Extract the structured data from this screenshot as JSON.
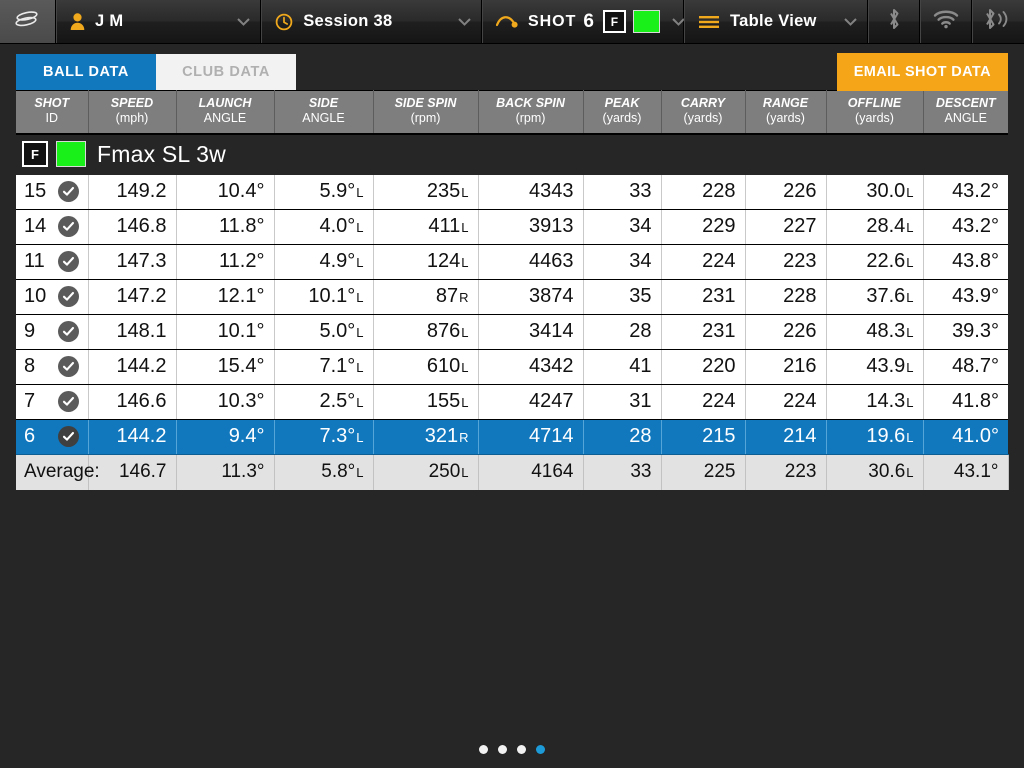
{
  "topbar": {
    "logo_icon": "swing-logo-icon",
    "user": {
      "icon": "person-icon",
      "label": "J M",
      "chevron": "chevron-down-icon"
    },
    "session": {
      "icon": "clock-icon",
      "label": "Session 38",
      "chevron": "chevron-down-icon"
    },
    "shot": {
      "icon": "ball-flight-icon",
      "label": "SHOT",
      "number": "6",
      "flag": "F",
      "color_chip": "#19f019",
      "chevron": "chevron-down-icon"
    },
    "view": {
      "icon": "list-lines-icon",
      "label": "Table View",
      "chevron": "chevron-down-icon"
    },
    "status_icons": [
      "bluetooth-icon",
      "wifi-icon",
      "bluetooth-broadcast-icon"
    ]
  },
  "tabs": {
    "ball_data": "BALL DATA",
    "club_data": "CLUB DATA",
    "active": "BALL DATA"
  },
  "actions": {
    "email_shot_data": "EMAIL SHOT DATA"
  },
  "table": {
    "columns": [
      {
        "name": "SHOT",
        "unit": "ID"
      },
      {
        "name": "SPEED",
        "unit": "(mph)"
      },
      {
        "name": "LAUNCH",
        "unit": "ANGLE"
      },
      {
        "name": "SIDE",
        "unit": "ANGLE"
      },
      {
        "name": "SIDE SPIN",
        "unit": "(rpm)"
      },
      {
        "name": "BACK SPIN",
        "unit": "(rpm)"
      },
      {
        "name": "PEAK",
        "unit": "(yards)"
      },
      {
        "name": "CARRY",
        "unit": "(yards)"
      },
      {
        "name": "RANGE",
        "unit": "(yards)"
      },
      {
        "name": "OFFLINE",
        "unit": "(yards)"
      },
      {
        "name": "DESCENT",
        "unit": "ANGLE"
      }
    ],
    "group": {
      "flag": "F",
      "color_chip": "#19f019",
      "club_name": "Fmax SL 3w"
    },
    "rows": [
      {
        "id": "15",
        "checked": true,
        "selected": false,
        "speed": "149.2",
        "launch_angle": "10.4°",
        "side_angle": "5.9°",
        "side_angle_dir": "L",
        "side_spin": "235",
        "side_spin_dir": "L",
        "back_spin": "4343",
        "peak": "33",
        "carry": "228",
        "range": "226",
        "offline": "30.0",
        "offline_dir": "L",
        "descent_angle": "43.2°"
      },
      {
        "id": "14",
        "checked": true,
        "selected": false,
        "speed": "146.8",
        "launch_angle": "11.8°",
        "side_angle": "4.0°",
        "side_angle_dir": "L",
        "side_spin": "411",
        "side_spin_dir": "L",
        "back_spin": "3913",
        "peak": "34",
        "carry": "229",
        "range": "227",
        "offline": "28.4",
        "offline_dir": "L",
        "descent_angle": "43.2°"
      },
      {
        "id": "11",
        "checked": true,
        "selected": false,
        "speed": "147.3",
        "launch_angle": "11.2°",
        "side_angle": "4.9°",
        "side_angle_dir": "L",
        "side_spin": "124",
        "side_spin_dir": "L",
        "back_spin": "4463",
        "peak": "34",
        "carry": "224",
        "range": "223",
        "offline": "22.6",
        "offline_dir": "L",
        "descent_angle": "43.8°"
      },
      {
        "id": "10",
        "checked": true,
        "selected": false,
        "speed": "147.2",
        "launch_angle": "12.1°",
        "side_angle": "10.1°",
        "side_angle_dir": "L",
        "side_spin": "87",
        "side_spin_dir": "R",
        "back_spin": "3874",
        "peak": "35",
        "carry": "231",
        "range": "228",
        "offline": "37.6",
        "offline_dir": "L",
        "descent_angle": "43.9°"
      },
      {
        "id": "9",
        "checked": true,
        "selected": false,
        "speed": "148.1",
        "launch_angle": "10.1°",
        "side_angle": "5.0°",
        "side_angle_dir": "L",
        "side_spin": "876",
        "side_spin_dir": "L",
        "back_spin": "3414",
        "peak": "28",
        "carry": "231",
        "range": "226",
        "offline": "48.3",
        "offline_dir": "L",
        "descent_angle": "39.3°"
      },
      {
        "id": "8",
        "checked": true,
        "selected": false,
        "speed": "144.2",
        "launch_angle": "15.4°",
        "side_angle": "7.1°",
        "side_angle_dir": "L",
        "side_spin": "610",
        "side_spin_dir": "L",
        "back_spin": "4342",
        "peak": "41",
        "carry": "220",
        "range": "216",
        "offline": "43.9",
        "offline_dir": "L",
        "descent_angle": "48.7°"
      },
      {
        "id": "7",
        "checked": true,
        "selected": false,
        "speed": "146.6",
        "launch_angle": "10.3°",
        "side_angle": "2.5°",
        "side_angle_dir": "L",
        "side_spin": "155",
        "side_spin_dir": "L",
        "back_spin": "4247",
        "peak": "31",
        "carry": "224",
        "range": "224",
        "offline": "14.3",
        "offline_dir": "L",
        "descent_angle": "41.8°"
      },
      {
        "id": "6",
        "checked": true,
        "selected": true,
        "speed": "144.2",
        "launch_angle": "9.4°",
        "side_angle": "7.3°",
        "side_angle_dir": "L",
        "side_spin": "321",
        "side_spin_dir": "R",
        "back_spin": "4714",
        "peak": "28",
        "carry": "215",
        "range": "214",
        "offline": "19.6",
        "offline_dir": "L",
        "descent_angle": "41.0°"
      }
    ],
    "average": {
      "label": "Average:",
      "speed": "146.7",
      "launch_angle": "11.3°",
      "side_angle": "5.8°",
      "side_angle_dir": "L",
      "side_spin": "250",
      "side_spin_dir": "L",
      "back_spin": "4164",
      "peak": "33",
      "carry": "225",
      "range": "223",
      "offline": "30.6",
      "offline_dir": "L",
      "descent_angle": "43.1°"
    }
  },
  "pagination": {
    "total": 4,
    "active_index": 3
  },
  "colors": {
    "accent_blue": "#1278be",
    "orange": "#f5a518",
    "green_chip": "#19f019",
    "header_gray": "#7e7e7e"
  }
}
